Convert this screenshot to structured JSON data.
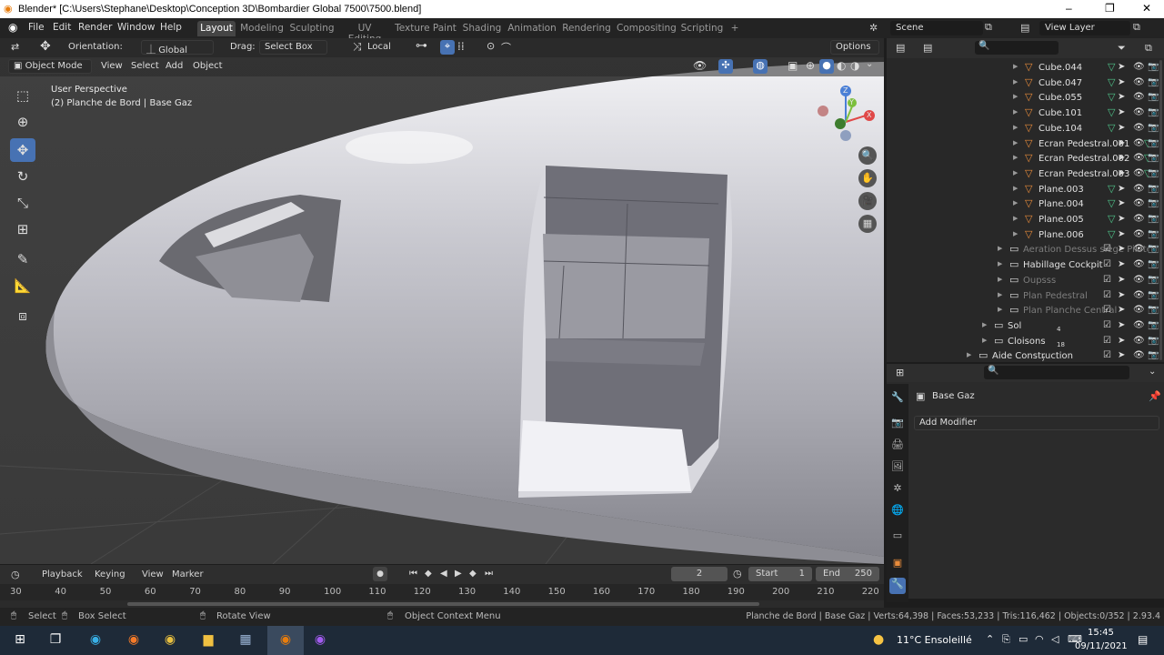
{
  "window": {
    "title": "Blender* [C:\\Users\\Stephane\\Desktop\\Conception 3D\\Bombardier Global 7500\\7500.blend]",
    "minimize": "–",
    "maximize": "❐",
    "close": "✕"
  },
  "menu": [
    "File",
    "Edit",
    "Render",
    "Window",
    "Help"
  ],
  "workspaces": [
    "Layout",
    "Modeling",
    "Sculpting",
    "UV Editing",
    "Texture Paint",
    "Shading",
    "Animation",
    "Rendering",
    "Compositing",
    "Scripting",
    "+"
  ],
  "scene": {
    "name": "Scene",
    "view_layer": "View Layer"
  },
  "toolbar": {
    "orientation_label": "Orientation:",
    "orientation_value": "Global",
    "drag_label": "Drag:",
    "drag_value": "Select Box",
    "pivot_value": "Local",
    "options": "Options"
  },
  "viewport_header": {
    "mode": "Object Mode",
    "menus": [
      "View",
      "Select",
      "Add",
      "Object"
    ]
  },
  "viewport_overlay": {
    "perspective": "User Perspective",
    "object": "(2) Planche de Bord | Base Gaz"
  },
  "gizmo": {
    "z": "Z",
    "y": "Y",
    "x": "X"
  },
  "outliner": [
    {
      "name": "Cube.044",
      "indent": 3,
      "dim": false
    },
    {
      "name": "Cube.047",
      "indent": 3,
      "dim": false
    },
    {
      "name": "Cube.055",
      "indent": 3,
      "dim": false
    },
    {
      "name": "Cube.101",
      "indent": 3,
      "dim": false
    },
    {
      "name": "Cube.104",
      "indent": 3,
      "dim": false
    },
    {
      "name": "Ecran Pedestral.001",
      "indent": 3,
      "dim": false
    },
    {
      "name": "Ecran Pedestral.002",
      "indent": 3,
      "dim": false
    },
    {
      "name": "Ecran Pedestral.003",
      "indent": 3,
      "dim": false
    },
    {
      "name": "Plane.003",
      "indent": 3,
      "dim": false
    },
    {
      "name": "Plane.004",
      "indent": 3,
      "dim": false
    },
    {
      "name": "Plane.005",
      "indent": 3,
      "dim": false
    },
    {
      "name": "Plane.006",
      "indent": 3,
      "dim": false
    },
    {
      "name": "Aeration Dessus siège Pilote",
      "indent": 2,
      "dim": true,
      "collection": true
    },
    {
      "name": "Habillage Cockpit",
      "indent": 2,
      "dim": false,
      "collection": true
    },
    {
      "name": "Oupsss",
      "indent": 2,
      "dim": true,
      "collection": true
    },
    {
      "name": "Plan Pedestral",
      "indent": 2,
      "dim": true,
      "collection": true
    },
    {
      "name": "Plan Planche Central",
      "indent": 2,
      "dim": true,
      "collection": true
    },
    {
      "name": "Sol",
      "indent": 1,
      "dim": false,
      "collection": true,
      "badge": "4"
    },
    {
      "name": "Cloisons",
      "indent": 1,
      "dim": false,
      "collection": true,
      "badge": "18"
    },
    {
      "name": "Aide Construction",
      "indent": 0,
      "dim": false,
      "collection": true,
      "badge": "7"
    }
  ],
  "properties": {
    "object_name": "Base Gaz",
    "add_modifier": "Add Modifier"
  },
  "timeline": {
    "menus": [
      "Playback",
      "Keying",
      "View",
      "Marker"
    ],
    "current_frame": "2",
    "start_label": "Start",
    "start": "1",
    "end_label": "End",
    "end": "250",
    "ruler": [
      "30",
      "40",
      "50",
      "60",
      "70",
      "80",
      "90",
      "100",
      "110",
      "120",
      "130",
      "140",
      "150",
      "160",
      "170",
      "180",
      "190",
      "200",
      "210",
      "220"
    ]
  },
  "statusbar": {
    "select": "Select",
    "box_select": "Box Select",
    "rotate_view": "Rotate View",
    "context_menu": "Object Context Menu",
    "stats": "Planche de Bord | Base Gaz | Verts:64,398 | Faces:53,233 | Tris:116,462 | Objects:0/352 | 2.93.4"
  },
  "taskbar": {
    "weather": "11°C  Ensoleillé",
    "time": "15:45",
    "date": "09/11/2021"
  }
}
